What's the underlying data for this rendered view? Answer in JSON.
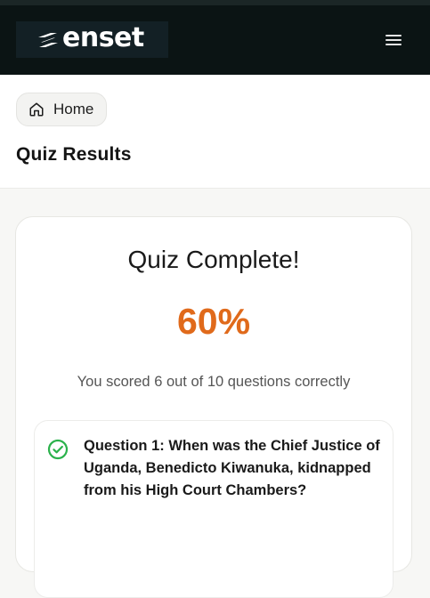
{
  "header": {
    "logo_text": "enset",
    "menu_icon": "hamburger-icon"
  },
  "breadcrumb": {
    "home_label": "Home",
    "home_icon": "home-icon"
  },
  "page": {
    "title": "Quiz Results"
  },
  "result": {
    "title": "Quiz Complete!",
    "score_percent": "60%",
    "score_summary": "You scored 6 out of 10 questions correctly",
    "correct": 6,
    "total": 10
  },
  "questions": [
    {
      "text": "Question 1: When was the Chief Justice of Uganda, Benedicto Kiwanuka, kidnapped from his High Court Chambers?",
      "status": "correct",
      "status_icon": "check-circle-icon"
    }
  ],
  "colors": {
    "accent": "#e06a1b",
    "header_bg": "#0b1414",
    "correct": "#2bb24c"
  }
}
